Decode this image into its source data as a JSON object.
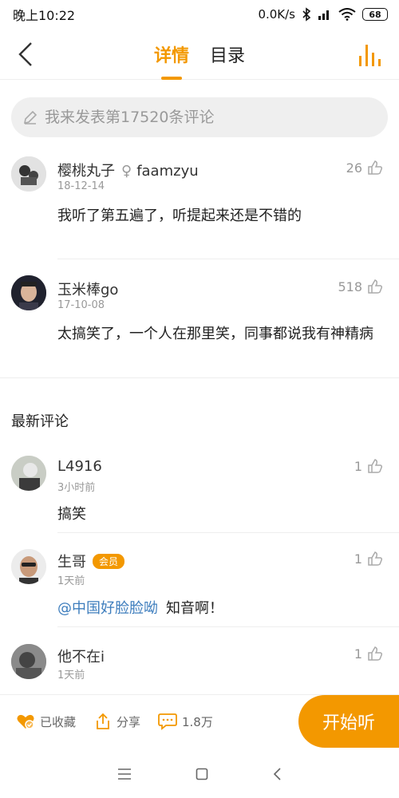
{
  "status_bar": {
    "time": "晚上10:22",
    "network_speed": "0.0K/s",
    "battery": "68"
  },
  "nav": {
    "tabs": [
      {
        "label": "详情",
        "active": true
      },
      {
        "label": "目录",
        "active": false
      }
    ]
  },
  "comment_input": {
    "placeholder": "我来发表第17520条评论"
  },
  "hot_comments": [
    {
      "name": "樱桃丸子",
      "gender": "♀",
      "handle": "faamzyu",
      "date": "18-12-14",
      "likes": "26",
      "text": "我听了第五遍了，听提起来还是不错的"
    },
    {
      "name": "玉米棒go",
      "date": "17-10-08",
      "likes": "518",
      "text": "太搞笑了，一个人在那里笑，同事都说我有神精病"
    }
  ],
  "latest_section_title": "最新评论",
  "latest_comments": [
    {
      "name": "L4916",
      "date": "3小时前",
      "likes": "1",
      "text": "搞笑"
    },
    {
      "name": "生哥",
      "badge": "会员",
      "date": "1天前",
      "likes": "1",
      "mention": "@中国好脸脸呦",
      "text": "知音啊！"
    },
    {
      "name": "他不在i",
      "date": "1天前",
      "likes": "1"
    }
  ],
  "action_bar": {
    "collect_label": "已收藏",
    "share_label": "分享",
    "comments_count": "1.8万",
    "start_label": "开始听"
  },
  "colors": {
    "accent": "#f39800",
    "mention": "#3d7dbd"
  }
}
